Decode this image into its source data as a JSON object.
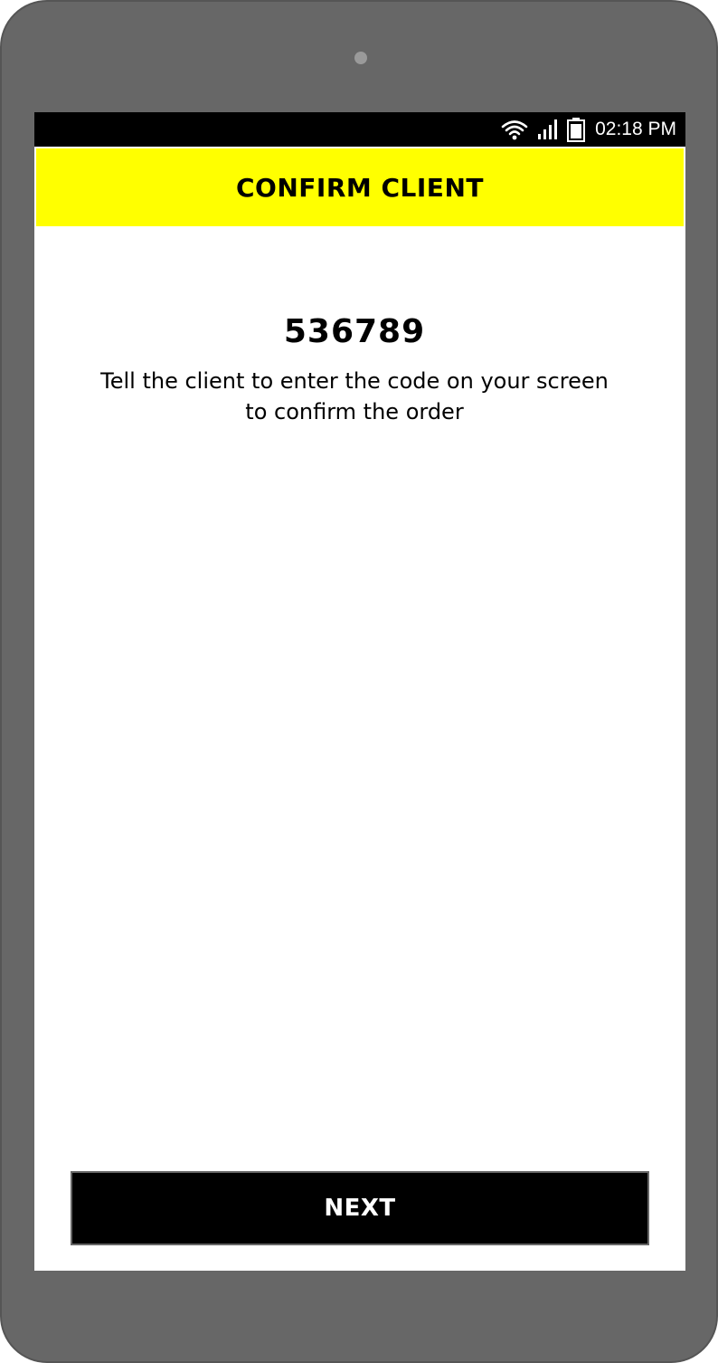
{
  "device": {
    "frame_color": "#676767"
  },
  "status_bar": {
    "time": "02:18 PM",
    "icons": [
      "wifi-icon",
      "signal-icon",
      "battery-icon"
    ]
  },
  "header": {
    "title": "CONFIRM CLIENT",
    "background_color": "#ffff00"
  },
  "main": {
    "code": "536789",
    "instruction_line_1": "Tell the client to enter the code on your screen",
    "instruction_line_2": "to confirm the order"
  },
  "footer": {
    "next_label": "NEXT"
  }
}
